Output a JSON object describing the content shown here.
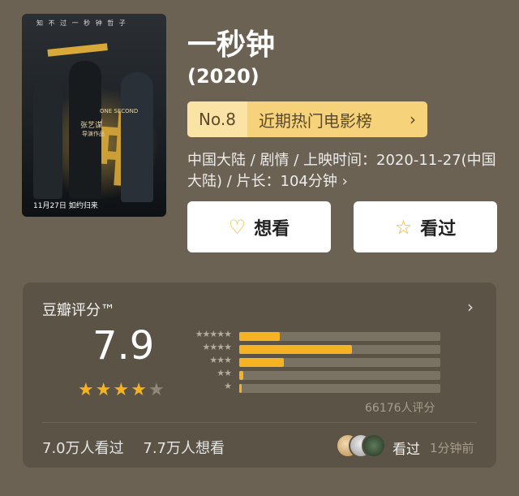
{
  "poster": {
    "top_text": "知 不 过 一 秒 钟 哲 子",
    "char_1": "一",
    "char_2": "钟",
    "english": "ONE SECOND",
    "director": "张艺谋",
    "director_sub": "导演作品",
    "release": "11月27日 如约归来"
  },
  "movie": {
    "title": "一秒钟",
    "year": "(2020)",
    "rank_no": "No.8",
    "rank_list": "近期热门电影榜",
    "meta": "中国大陆 / 剧情 / 上映时间：2020-11-27(中国大陆) / 片长：104分钟 ›"
  },
  "actions": {
    "want_label": "想看",
    "seen_label": "看过"
  },
  "rating": {
    "header": "豆瓣评分™",
    "score": "7.9",
    "stars_filled": 4,
    "stars_total": 5,
    "distribution": [
      {
        "stars": 5,
        "label": "★★★★★",
        "fraction": 0.2
      },
      {
        "stars": 4,
        "label": "★★★★",
        "fraction": 0.56
      },
      {
        "stars": 3,
        "label": "★★★",
        "fraction": 0.22
      },
      {
        "stars": 2,
        "label": "★★",
        "fraction": 0.02
      },
      {
        "stars": 1,
        "label": "★",
        "fraction": 0.005
      }
    ],
    "count_text": "66176人评分",
    "seen_count": "7.0万人看过",
    "want_count": "7.7万人想看",
    "friend_action": "看过",
    "friend_time": "1分钟前"
  },
  "colors": {
    "background": "#6b6253",
    "card": "#5b5345",
    "accent": "#f5b323",
    "rank_badge": "#f6d27a"
  }
}
